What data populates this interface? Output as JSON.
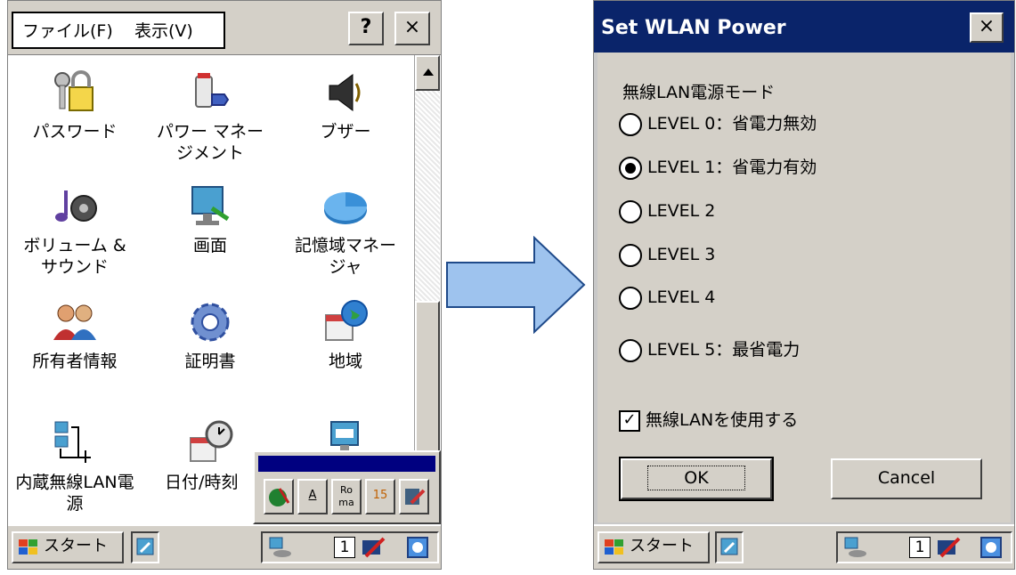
{
  "left": {
    "menu": {
      "file": "ファイル(F)",
      "view": "表示(V)"
    },
    "help_button": "?",
    "close_button": "×",
    "items": [
      {
        "label": "パスワード",
        "icon": "keys-lock-icon"
      },
      {
        "label": "パワー マネージメント",
        "icon": "power-plug-icon"
      },
      {
        "label": "ブザー",
        "icon": "speaker-icon"
      },
      {
        "label": "ボリューム & サウンド",
        "icon": "music-note-icon"
      },
      {
        "label": "画面",
        "icon": "display-icon"
      },
      {
        "label": "記憶域マネージャ",
        "icon": "pie-disk-icon"
      },
      {
        "label": "所有者情報",
        "icon": "owner-people-icon"
      },
      {
        "label": "証明書",
        "icon": "gear-cert-icon"
      },
      {
        "label": "地域",
        "icon": "globe-calendar-icon"
      },
      {
        "label": "内蔵無線LAN電源",
        "icon": "network-computers-icon"
      },
      {
        "label": "日付/時刻",
        "icon": "calendar-clock-icon"
      },
      {
        "label": "",
        "icon": "input-panel-icon"
      }
    ],
    "ime_buttons": [
      "",
      "A",
      "Ro ma",
      "15",
      ""
    ]
  },
  "taskbar": {
    "start": "スタート",
    "tray_number": "1"
  },
  "dialog": {
    "title": "Set WLAN Power",
    "close": "×",
    "group_label": "無線LAN電源モード",
    "options": [
      {
        "label": "LEVEL 0：省電力無効",
        "checked": false
      },
      {
        "label": "LEVEL 1：省電力有効",
        "checked": true
      },
      {
        "label": "LEVEL 2",
        "checked": false
      },
      {
        "label": "LEVEL 3",
        "checked": false
      },
      {
        "label": "LEVEL 4",
        "checked": false
      },
      {
        "label": "LEVEL 5：最省電力",
        "checked": false
      }
    ],
    "checkbox_label": "無線LANを使用する",
    "checkbox_checked": true,
    "ok": "OK",
    "cancel": "Cancel"
  },
  "colors": {
    "title_bar": "#0a246a",
    "window_face": "#d4d0c8",
    "arrow_fill": "#9ec3ee"
  }
}
